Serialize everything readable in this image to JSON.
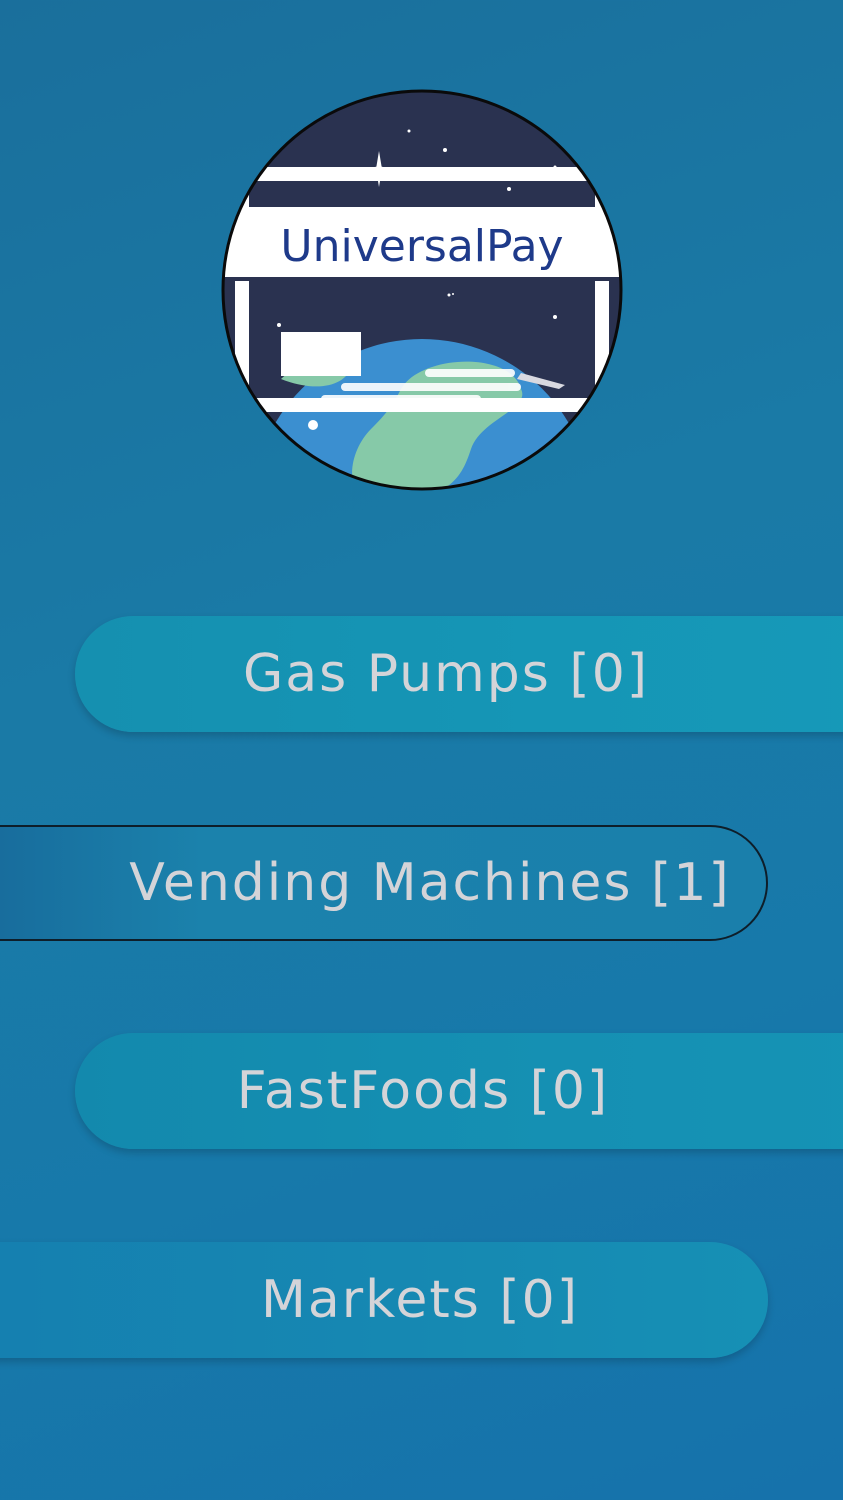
{
  "app": {
    "logo_text": "UniversalPay"
  },
  "menu": {
    "items": [
      {
        "label": "Gas Pumps [0]"
      },
      {
        "label": "Vending Machines [1]"
      },
      {
        "label": "FastFoods [0]"
      },
      {
        "label": "Markets [0]"
      }
    ]
  },
  "colors": {
    "background": "#1a77a6",
    "button_text": "#d4d4d8",
    "logo_text": "#1e3a8a",
    "logo_space": "#2a3250",
    "logo_ocean": "#3b8fd0",
    "logo_land": "#86c9a8"
  }
}
